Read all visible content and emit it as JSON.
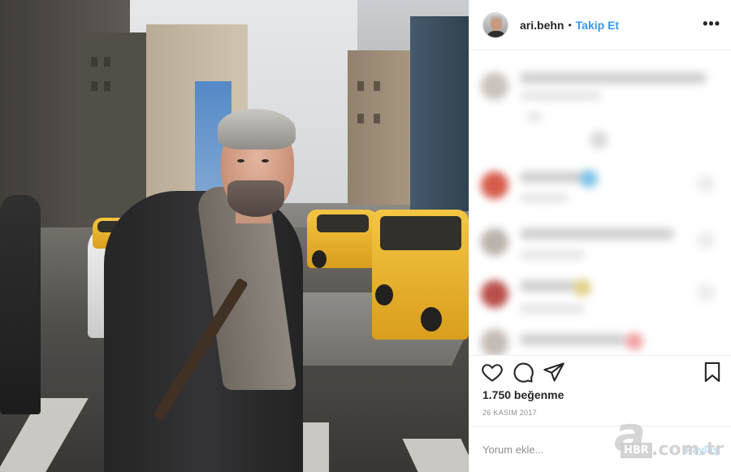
{
  "post": {
    "username": "ari.behn",
    "separator": "•",
    "follow_label": "Takip Et",
    "more_icon": "more-dots-icon",
    "more_glyph": "•••"
  },
  "engagement": {
    "likes": "1.750 beğenme",
    "date": "26 KASIM 2017"
  },
  "comment_box": {
    "placeholder": "Yorum ekle...",
    "share_label": "Paylaş"
  },
  "icons": {
    "like": "heart-icon",
    "comment": "comment-bubble-icon",
    "share": "paper-plane-icon",
    "save": "bookmark-icon"
  },
  "watermark": {
    "letter": "a",
    "brand": "HBR",
    "domain": ".com.tr"
  },
  "colors": {
    "accent": "#3897f0",
    "text": "#262626",
    "muted": "#8e8e8e",
    "share_disabled": "#b2dffc"
  }
}
